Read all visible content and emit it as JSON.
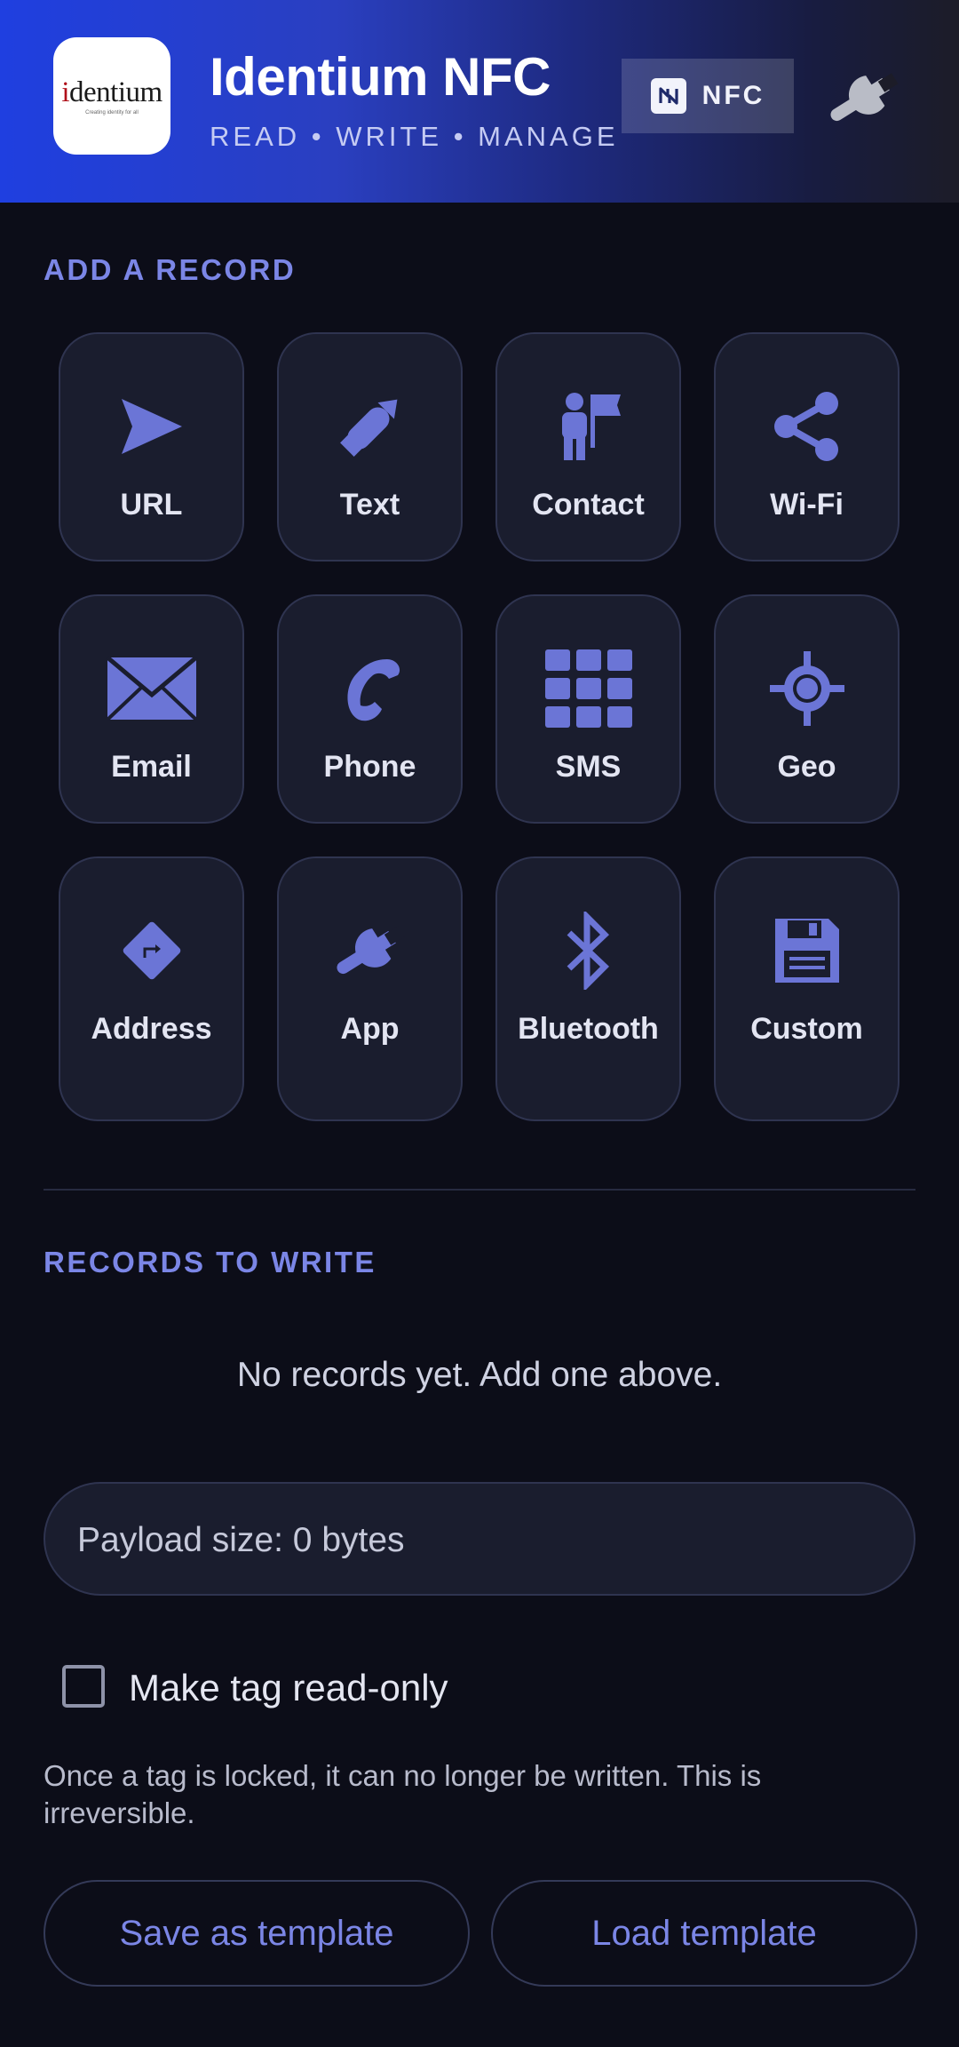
{
  "header": {
    "logo_text": "identium",
    "logo_tagline": "Creating identity for all",
    "title": "Identium NFC",
    "subtitle": "READ • WRITE • MANAGE",
    "nfc_badge": "NFC",
    "settings_icon": "wrench-icon"
  },
  "add_record": {
    "heading": "ADD A RECORD",
    "tiles": [
      {
        "label": "URL",
        "icon": "send-icon"
      },
      {
        "label": "Text",
        "icon": "pencil-icon"
      },
      {
        "label": "Contact",
        "icon": "person-flag-icon"
      },
      {
        "label": "Wi-Fi",
        "icon": "share-icon"
      },
      {
        "label": "Email",
        "icon": "envelope-icon"
      },
      {
        "label": "Phone",
        "icon": "phone-icon"
      },
      {
        "label": "SMS",
        "icon": "keypad-icon"
      },
      {
        "label": "Geo",
        "icon": "crosshair-icon"
      },
      {
        "label": "Address",
        "icon": "directions-icon"
      },
      {
        "label": "App",
        "icon": "wrench-icon"
      },
      {
        "label": "Bluetooth",
        "icon": "bluetooth-icon"
      },
      {
        "label": "Custom",
        "icon": "floppy-disk-icon"
      }
    ]
  },
  "records": {
    "heading": "RECORDS TO WRITE",
    "empty_message": "No records yet. Add one above.",
    "payload_size": "Payload size: 0 bytes"
  },
  "read_only": {
    "checked": false,
    "label": "Make tag read-only",
    "warning": "Once a tag is locked, it can no longer be written. This is irreversible."
  },
  "actions": {
    "save_template": "Save as template",
    "load_template": "Load template"
  },
  "colors": {
    "accent": "#7b86e6",
    "background": "#0c0d18",
    "tile": "#1a1d2e",
    "header_start": "#1f3fe0"
  }
}
